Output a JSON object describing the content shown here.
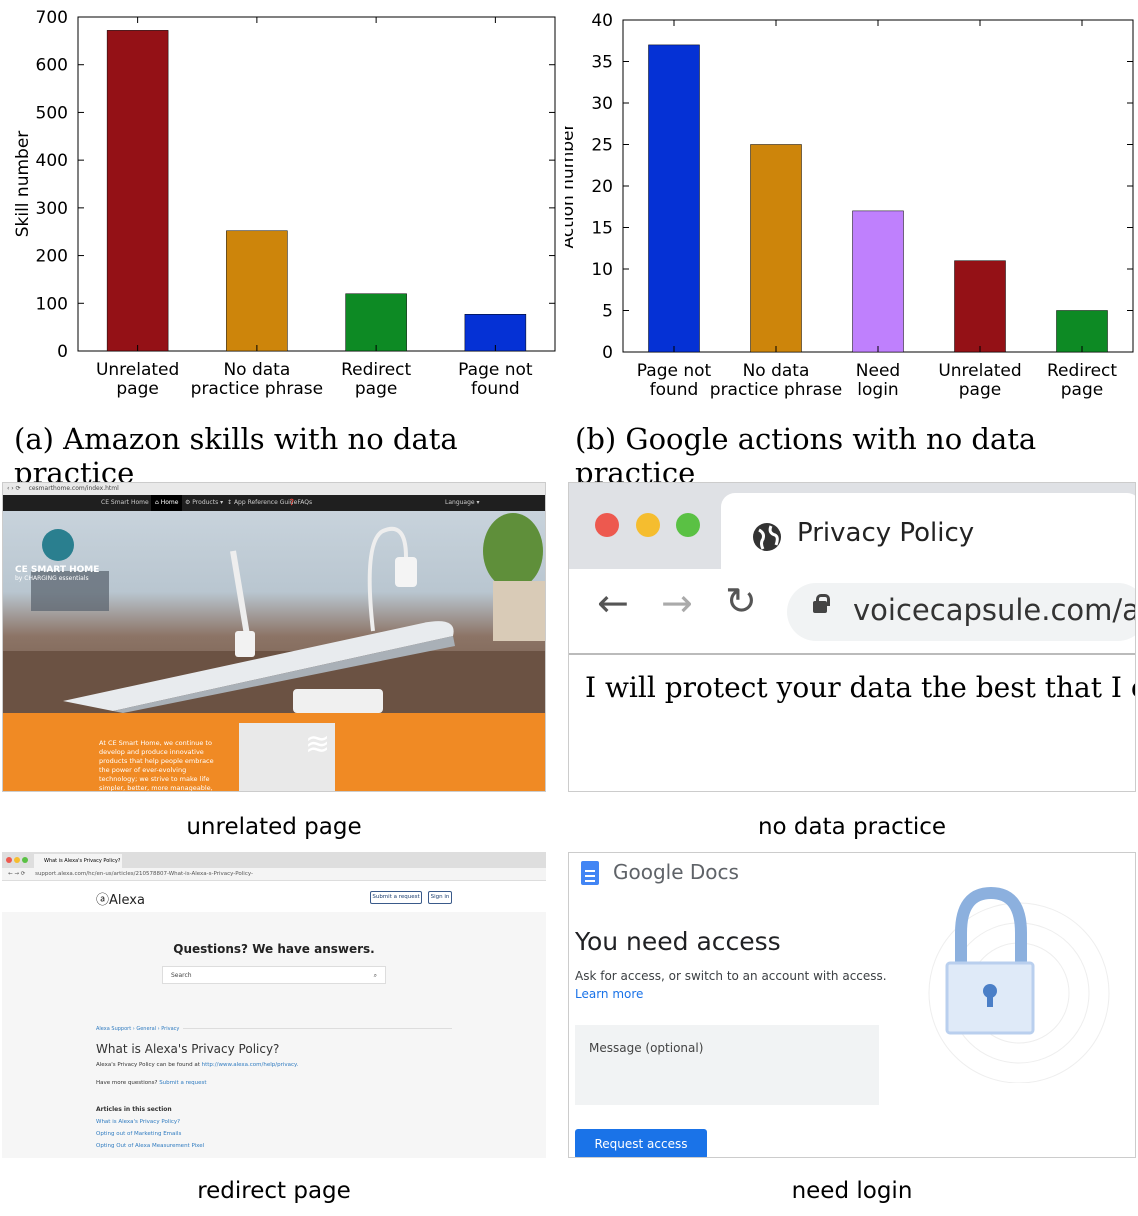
{
  "chart_data": [
    {
      "type": "bar",
      "categories": [
        "Unrelated page",
        "No data practice phrase",
        "Redirect page",
        "Page not found"
      ],
      "values": [
        672,
        252,
        120,
        77
      ],
      "colors": [
        "#941116",
        "#cd850b",
        "#0d8a24",
        "#0531d5"
      ],
      "ylabel": "Skill number",
      "ylim": [
        0,
        700
      ],
      "yticks": [
        "0",
        "100",
        "200",
        "300",
        "400",
        "500",
        "600",
        "700"
      ],
      "grid": false
    },
    {
      "type": "bar",
      "categories": [
        "Page not found",
        "No data practice phrase",
        "Need login",
        "Unrelated page",
        "Redirect page"
      ],
      "values": [
        37,
        25,
        17,
        11,
        5
      ],
      "colors": [
        "#0531d5",
        "#cd850b",
        "#bf80fd",
        "#941116",
        "#0d8a24"
      ],
      "ylabel": "Action number",
      "ylim": [
        0,
        40
      ],
      "yticks": [
        "0",
        "5",
        "10",
        "15",
        "20",
        "25",
        "30",
        "35",
        "40"
      ],
      "grid": false
    }
  ],
  "charts": [
    {
      "caption": "(a)  Amazon skills with no data practice",
      "ylabel": "Skill number",
      "yticks": [
        "0",
        "100",
        "200",
        "300",
        "400",
        "500",
        "600",
        "700"
      ],
      "xticks": [
        [
          "Unrelated",
          "page"
        ],
        [
          "No data",
          "practice phrase"
        ],
        [
          "Redirect",
          "page"
        ],
        [
          "Page not",
          "found"
        ]
      ]
    },
    {
      "caption": "(b)  Google actions with no data practice",
      "ylabel": "Action number",
      "yticks": [
        "0",
        "5",
        "10",
        "15",
        "20",
        "25",
        "30",
        "35",
        "40"
      ],
      "xticks": [
        [
          "Page not",
          "found"
        ],
        [
          "No data",
          "practice phrase"
        ],
        [
          "Need",
          "login"
        ],
        [
          "Unrelated",
          "page"
        ],
        [
          "Redirect",
          "page"
        ]
      ]
    }
  ],
  "captions": {
    "unrelated": "unrelated page",
    "no_data": "no data practice",
    "redirect": "redirect page",
    "login": "need login"
  },
  "ce": {
    "url": "cesmarthome.com/index.html",
    "nav_brand": "CE Smart Home",
    "nav_home": "Home",
    "nav_products": "Products",
    "nav_guide": "App Reference Guide",
    "nav_faqs": "FAQs",
    "nav_language": "Language",
    "logo_line1": "CE SMART HOME",
    "logo_line2": "by CHARGING essentials",
    "body_text": "At CE Smart Home, we continue to develop and produce innovative products that help people embrace the power of ever-evolving technology; we strive to make life simpler, better, more manageable, and above all, enjoyable."
  },
  "privacy": {
    "tab_title": "Privacy Policy",
    "url": "voicecapsule.com/alexa",
    "body": "I will protect your data the best that I can."
  },
  "alexa": {
    "tab_title": "What is Alexa's Privacy Policy? -",
    "url": "support.alexa.com/hc/en-us/articles/210578807-What-is-Alexa-s-Privacy-Policy-",
    "logo": "Alexa",
    "submit_label": "Submit a request",
    "signin_label": "Sign in",
    "headline": "Questions? We have answers.",
    "search_placeholder": "Search",
    "breadcrumb": "Alexa Support  ›  General  ›  Privacy",
    "article_title": "What is Alexa's Privacy Policy?",
    "article_body": "Alexa's Privacy Policy can be found at",
    "article_link": "http://www.alexa.com/help/privacy.",
    "more_questions": "Have more questions?",
    "submit_link": "Submit a request",
    "section_heading": "Articles in this section",
    "section_links": [
      "What is Alexa's Privacy Policy?",
      "Opting out of Marketing Emails",
      "Opting Out of Alexa Measurement Pixel"
    ]
  },
  "gdocs": {
    "brand": "Google Docs",
    "heading": "You need access",
    "subtext": "Ask for access, or switch to an account with access.",
    "learn_more": "Learn more",
    "message_placeholder": "Message (optional)",
    "request_button": "Request access"
  }
}
